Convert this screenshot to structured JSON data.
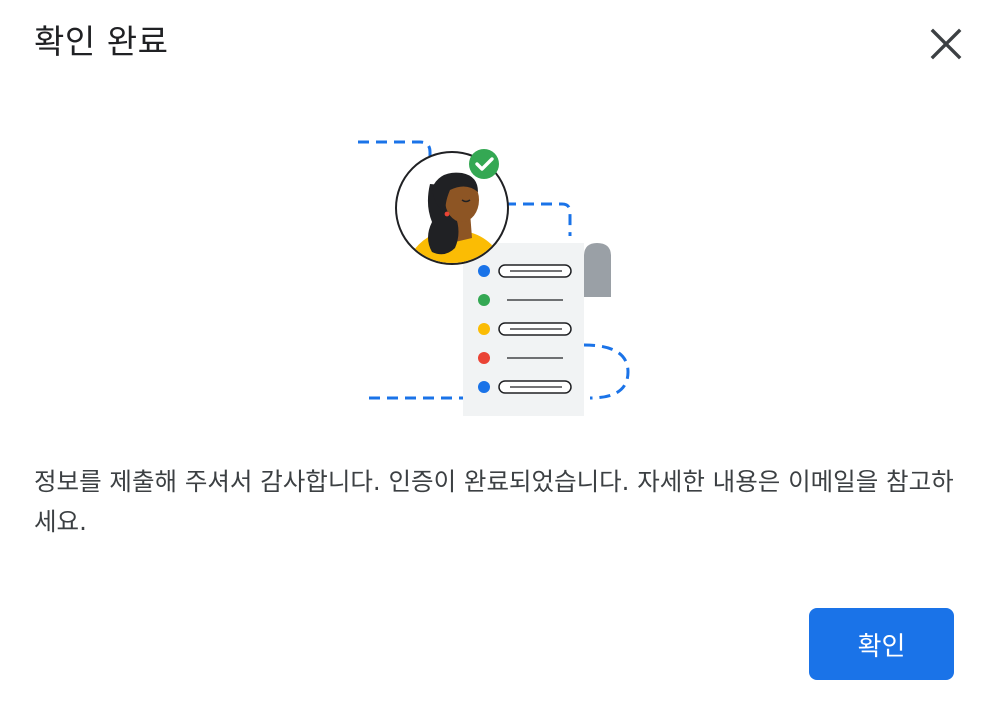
{
  "dialog": {
    "title": "확인 완료",
    "message": "정보를 제출해 주셔서 감사합니다. 인증이 완료되었습니다. 자세한 내용은 이메일을 참고하세요.",
    "confirm_label": "확인",
    "close_icon": "close-icon"
  },
  "illustration": {
    "items": [
      {
        "dot_color": "#1a73e8",
        "style": "pill"
      },
      {
        "dot_color": "#34a853",
        "style": "line"
      },
      {
        "dot_color": "#fbbc04",
        "style": "pill"
      },
      {
        "dot_color": "#ea4335",
        "style": "line"
      },
      {
        "dot_color": "#1a73e8",
        "style": "pill"
      }
    ],
    "accent_color": "#1a73e8",
    "check_badge_color": "#34a853",
    "avatar_shirt_color": "#fbbc04"
  },
  "colors": {
    "primary": "#1a73e8",
    "text": "#202124"
  }
}
